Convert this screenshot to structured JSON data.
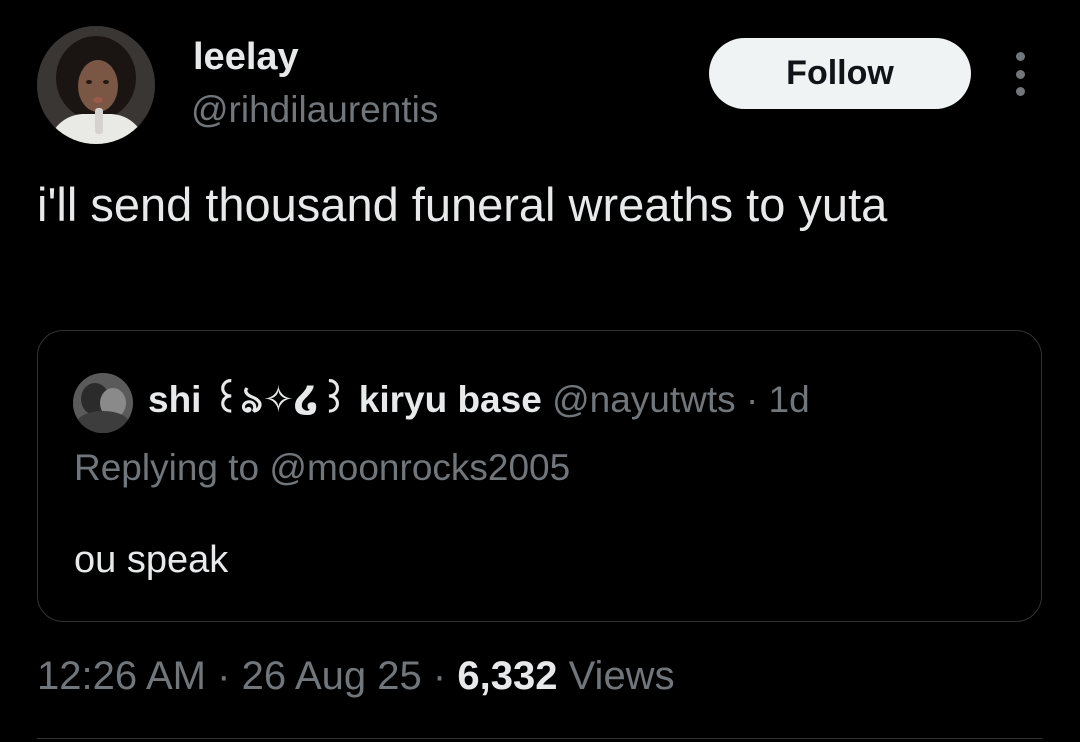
{
  "author": {
    "display_name": "leelay",
    "handle": "@rihdilaurentis"
  },
  "actions": {
    "follow_label": "Follow",
    "more_icon": "more-vertical-icon"
  },
  "tweet": {
    "text": "i'll send thousand funeral wreaths to yuta"
  },
  "quoted_tweet": {
    "display_name": "shi ꒰ঌ✧໒꒱ kiryu base",
    "handle": "@nayutwts",
    "separator": "·",
    "time": "1d",
    "replying_to": "Replying to @moonrocks2005",
    "text": "ou speak"
  },
  "meta": {
    "time": "12:26 AM",
    "separator": "·",
    "date": "26 Aug 25",
    "views_count": "6,332",
    "views_label": "Views"
  },
  "colors": {
    "background": "#000000",
    "primary_text": "#e7e9ea",
    "secondary_text": "#71767b",
    "border": "#2f3336",
    "follow_button_bg": "#eff3f4",
    "follow_button_text": "#0f1419"
  }
}
